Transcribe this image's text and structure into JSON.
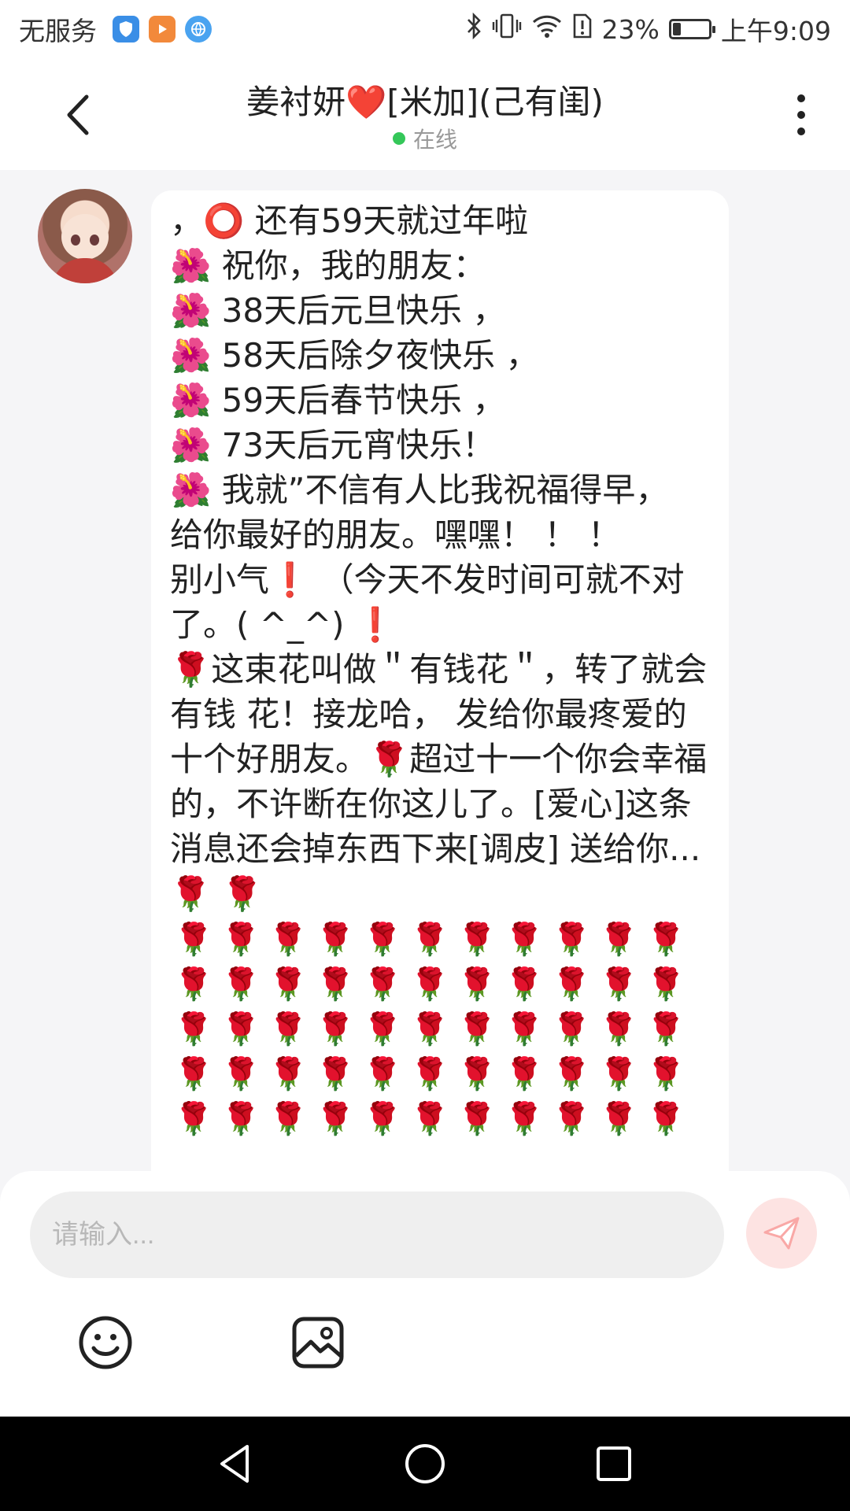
{
  "status_bar": {
    "carrier": "无服务",
    "battery_percent": "23%",
    "battery_level": 0.23,
    "time": "上午9:09",
    "icons": [
      "shield-app-icon",
      "video-app-icon",
      "browser-app-icon",
      "bluetooth-icon",
      "vibrate-icon",
      "wifi-icon",
      "sim-alert-icon",
      "battery-icon"
    ]
  },
  "header": {
    "title": "姜衬妍❤️[米加](己有闺)",
    "status": "在线",
    "status_color": "#34c759"
  },
  "message": {
    "text": "，⭕ 还有59天就过年啦\n🌺 祝你，我的朋友：\n🌺 38天后元旦快乐 ，\n🌺 58天后除夕夜快乐 ，\n🌺 59天后春节快乐 ，\n🌺 73天后元宵快乐！\n🌺 我就”不信有人比我祝福得早， 给你最好的朋友。嘿嘿！ ！ ！\n别小气❗ （今天不发时间可就不对了。( ^_^) ❗\n🌹这束花叫做＂有钱花＂，转了就会有钱 花！接龙哈， 发给你最疼爱的十个好朋友。🌹超过十一个你会幸福的，不许断在你这儿了。[爱心]这条消息还会掉东西下来[调皮] 送给你...🌹 🌹",
    "rose": "🌹",
    "rose_rows": 5,
    "rose_cols": 11
  },
  "input": {
    "placeholder": "请输入...",
    "value": ""
  },
  "toolbar": {
    "emoji_icon": "smiley-icon",
    "image_icon": "image-icon"
  },
  "colors": {
    "send_button_bg": "#fde3e2",
    "send_icon": "#f9a8a6",
    "chat_bg": "#f5f5f7"
  }
}
